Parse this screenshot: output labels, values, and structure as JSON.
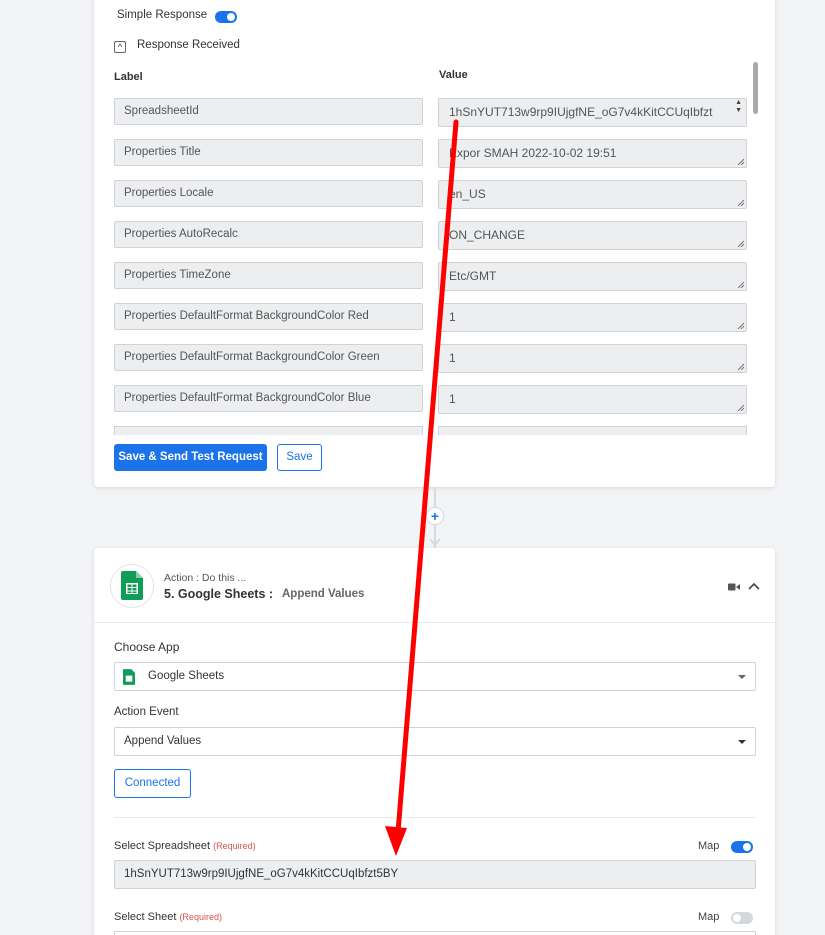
{
  "top": {
    "simple_response_label": "Simple Response",
    "response_received_label": "Response Received",
    "label_header": "Label",
    "value_header": "Value",
    "rows": [
      {
        "label": "SpreadsheetId",
        "value": "1hSnYUT713w9rp9IUjgfNE_oG7v4kKitCCUqIbfzt"
      },
      {
        "label": "Properties Title",
        "value": "Expor SMAH 2022-10-02 19:51"
      },
      {
        "label": "Properties Locale",
        "value": "en_US"
      },
      {
        "label": "Properties AutoRecalc",
        "value": "ON_CHANGE"
      },
      {
        "label": "Properties TimeZone",
        "value": "Etc/GMT"
      },
      {
        "label": "Properties DefaultFormat BackgroundColor Red",
        "value": "1"
      },
      {
        "label": "Properties DefaultFormat BackgroundColor Green",
        "value": "1"
      },
      {
        "label": "Properties DefaultFormat BackgroundColor Blue",
        "value": "1"
      }
    ],
    "save_send_label": "Save & Send Test Request",
    "save_label": "Save"
  },
  "action": {
    "prefix": "Action : Do this ...",
    "title": "5. Google Sheets :",
    "event_name": "Append Values",
    "choose_app_label": "Choose App",
    "app_value": "Google Sheets",
    "action_event_label": "Action Event",
    "action_event_value": "Append Values",
    "connected_label": "Connected",
    "spreadsheet_label": "Select Spreadsheet",
    "required_text": "(Required)",
    "map_label": "Map",
    "spreadsheet_value": "1hSnYUT713w9rp9IUjgfNE_oG7v4kKitCCUqIbfzt5BY",
    "sheet_label": "Select Sheet"
  },
  "colors": {
    "accent": "#1a73e8",
    "arrow": "#ff0000",
    "sheets_green": "#0f9d58"
  }
}
